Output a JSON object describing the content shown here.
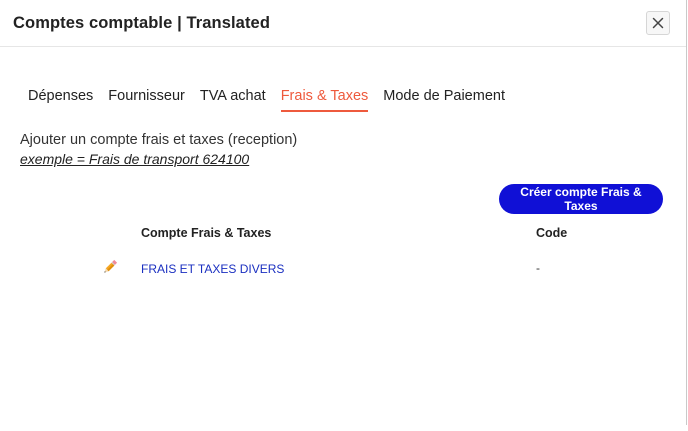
{
  "modal": {
    "title": "Comptes comptable | Translated",
    "close_label": "×"
  },
  "tabs": [
    {
      "label": "Dépenses",
      "active": false
    },
    {
      "label": "Fournisseur",
      "active": false
    },
    {
      "label": "TVA achat",
      "active": false
    },
    {
      "label": "Frais & Taxes",
      "active": true
    },
    {
      "label": "Mode de Paiement",
      "active": false
    }
  ],
  "content": {
    "description": "Ajouter un compte frais et taxes (reception)",
    "example": "exemple = Frais de transport 624100",
    "create_button": "Créer compte Frais & Taxes"
  },
  "table": {
    "headers": [
      "Compte Frais & Taxes",
      "Code"
    ],
    "rows": [
      {
        "name": "FRAIS ET TAXES DIVERS",
        "code": "-"
      }
    ]
  },
  "colors": {
    "accent": "#ee5a3d",
    "primary_button": "#1010d6",
    "link": "#1a2fc0"
  },
  "icons": {
    "close": "close-icon",
    "edit": "pencil-icon"
  }
}
